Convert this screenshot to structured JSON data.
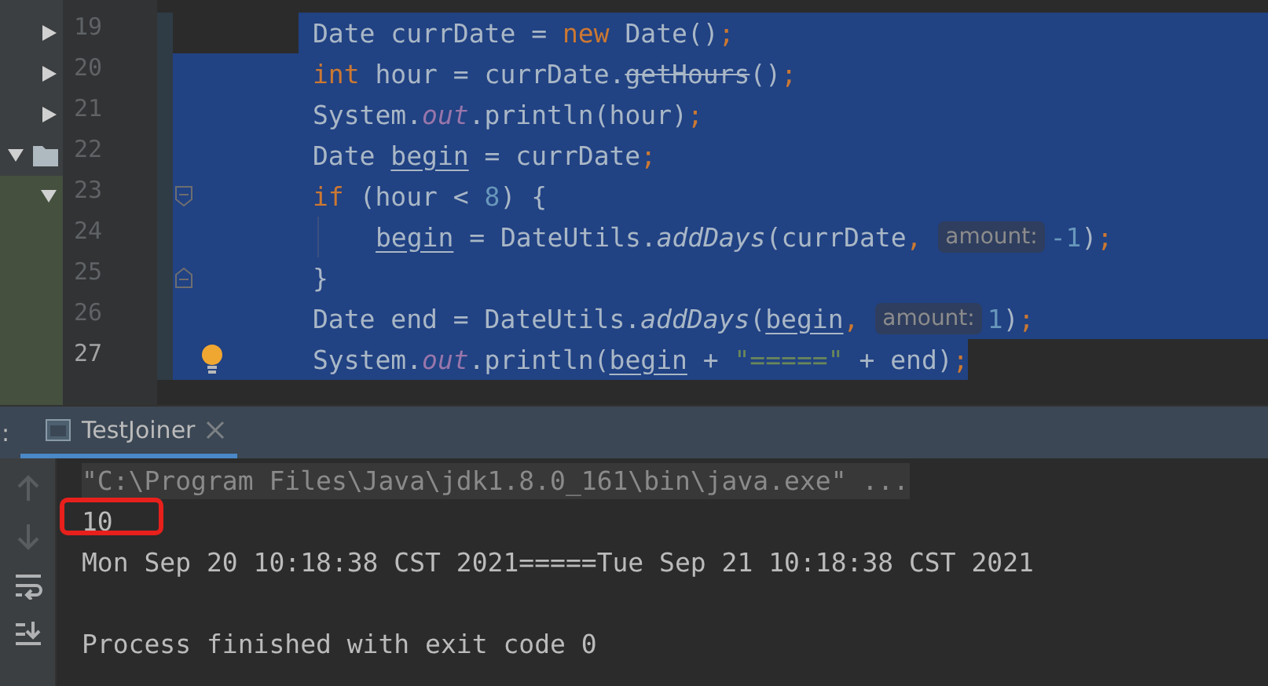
{
  "project_tree": {
    "rows": [
      {
        "expanded": false,
        "folder": false,
        "highlighted": false
      },
      {
        "expanded": false,
        "folder": false,
        "highlighted": false
      },
      {
        "expanded": false,
        "folder": false,
        "highlighted": false
      },
      {
        "expanded": true,
        "folder": true,
        "highlighted": false
      },
      {
        "expanded": true,
        "folder": false,
        "highlighted": true
      }
    ]
  },
  "editor": {
    "lines": [
      {
        "number": "19",
        "current": false,
        "select_margin": false,
        "select_to_end": true,
        "indented": false,
        "fold_start": false,
        "fold_end": false,
        "bulb": false,
        "tokens": [
          {
            "text": "Date currDate = ",
            "kind": "plain"
          },
          {
            "text": "new ",
            "kind": "keyword"
          },
          {
            "text": "Date()",
            "kind": "plain"
          },
          {
            "text": ";",
            "kind": "keyword"
          }
        ]
      },
      {
        "number": "20",
        "current": false,
        "select_margin": true,
        "select_to_end": true,
        "indented": false,
        "fold_start": false,
        "fold_end": false,
        "bulb": false,
        "tokens": [
          {
            "text": "int ",
            "kind": "keyword"
          },
          {
            "text": "hour = currDate.",
            "kind": "plain"
          },
          {
            "text": "getHours",
            "kind": "deprecated"
          },
          {
            "text": "()",
            "kind": "plain"
          },
          {
            "text": ";",
            "kind": "keyword"
          }
        ]
      },
      {
        "number": "21",
        "current": false,
        "select_margin": true,
        "select_to_end": true,
        "indented": false,
        "fold_start": false,
        "fold_end": false,
        "bulb": false,
        "tokens": [
          {
            "text": "System.",
            "kind": "plain"
          },
          {
            "text": "out",
            "kind": "static"
          },
          {
            "text": ".println(hour)",
            "kind": "plain"
          },
          {
            "text": ";",
            "kind": "keyword"
          }
        ]
      },
      {
        "number": "22",
        "current": false,
        "select_margin": true,
        "select_to_end": true,
        "indented": false,
        "fold_start": false,
        "fold_end": false,
        "bulb": false,
        "tokens": [
          {
            "text": "Date ",
            "kind": "plain"
          },
          {
            "text": "begin",
            "kind": "reassigned"
          },
          {
            "text": " = currDate",
            "kind": "plain"
          },
          {
            "text": ";",
            "kind": "keyword"
          }
        ]
      },
      {
        "number": "23",
        "current": false,
        "select_margin": true,
        "select_to_end": true,
        "indented": false,
        "fold_start": true,
        "fold_end": false,
        "bulb": false,
        "tokens": [
          {
            "text": "if ",
            "kind": "keyword"
          },
          {
            "text": "(hour < ",
            "kind": "plain"
          },
          {
            "text": "8",
            "kind": "number"
          },
          {
            "text": ") {",
            "kind": "plain"
          }
        ]
      },
      {
        "number": "24",
        "current": false,
        "select_margin": true,
        "select_to_end": true,
        "indented": true,
        "fold_start": false,
        "fold_end": false,
        "bulb": false,
        "tokens": [
          {
            "text": "begin",
            "kind": "reassigned"
          },
          {
            "text": " = DateUtils.",
            "kind": "plain"
          },
          {
            "text": "addDays",
            "kind": "method"
          },
          {
            "text": "(currDate",
            "kind": "plain"
          },
          {
            "text": ", ",
            "kind": "keyword"
          },
          {
            "text": "amount:",
            "kind": "hint"
          },
          {
            "text": "-1",
            "kind": "number"
          },
          {
            "text": ")",
            "kind": "plain"
          },
          {
            "text": ";",
            "kind": "keyword"
          }
        ]
      },
      {
        "number": "25",
        "current": false,
        "select_margin": true,
        "select_to_end": true,
        "indented": false,
        "fold_start": false,
        "fold_end": true,
        "bulb": false,
        "tokens": [
          {
            "text": "}",
            "kind": "plain"
          }
        ]
      },
      {
        "number": "26",
        "current": false,
        "select_margin": true,
        "select_to_end": true,
        "indented": false,
        "fold_start": false,
        "fold_end": false,
        "bulb": false,
        "tokens": [
          {
            "text": "Date end = DateUtils.",
            "kind": "plain"
          },
          {
            "text": "addDays",
            "kind": "method"
          },
          {
            "text": "(",
            "kind": "plain"
          },
          {
            "text": "begin",
            "kind": "reassigned"
          },
          {
            "text": ", ",
            "kind": "keyword"
          },
          {
            "text": "amount:",
            "kind": "hint"
          },
          {
            "text": "1",
            "kind": "number"
          },
          {
            "text": ")",
            "kind": "plain"
          },
          {
            "text": ";",
            "kind": "keyword"
          }
        ]
      },
      {
        "number": "27",
        "current": true,
        "select_margin": true,
        "select_to_end": false,
        "indented": false,
        "fold_start": false,
        "fold_end": false,
        "bulb": true,
        "tokens": [
          {
            "text": "System.",
            "kind": "plain"
          },
          {
            "text": "out",
            "kind": "static"
          },
          {
            "text": ".println(",
            "kind": "plain"
          },
          {
            "text": "begin",
            "kind": "reassigned"
          },
          {
            "text": " + ",
            "kind": "plain"
          },
          {
            "text": "\"=====\"",
            "kind": "string"
          },
          {
            "text": " + end)",
            "kind": "plain"
          },
          {
            "text": ";",
            "kind": "keyword"
          }
        ]
      }
    ]
  },
  "run_panel": {
    "prefix": ":",
    "tabs": [
      {
        "label": "TestJoiner",
        "selected": true,
        "closable": true
      }
    ],
    "toolbar": [
      {
        "kind": "up",
        "disabled": true
      },
      {
        "kind": "down",
        "disabled": true
      },
      {
        "kind": "wrap",
        "disabled": false
      },
      {
        "kind": "scroll_end",
        "disabled": false
      }
    ],
    "output": [
      {
        "kind": "command",
        "text": "\"C:\\Program Files\\Java\\jdk1.8.0_161\\bin\\java.exe\" ..."
      },
      {
        "kind": "boxed",
        "text": "10"
      },
      {
        "kind": "output",
        "text": "Mon Sep 20 10:18:38 CST 2021=====Tue Sep 21 10:18:38 CST 2021"
      },
      {
        "kind": "blank"
      },
      {
        "kind": "output",
        "text": "Process finished with exit code 0"
      }
    ]
  }
}
